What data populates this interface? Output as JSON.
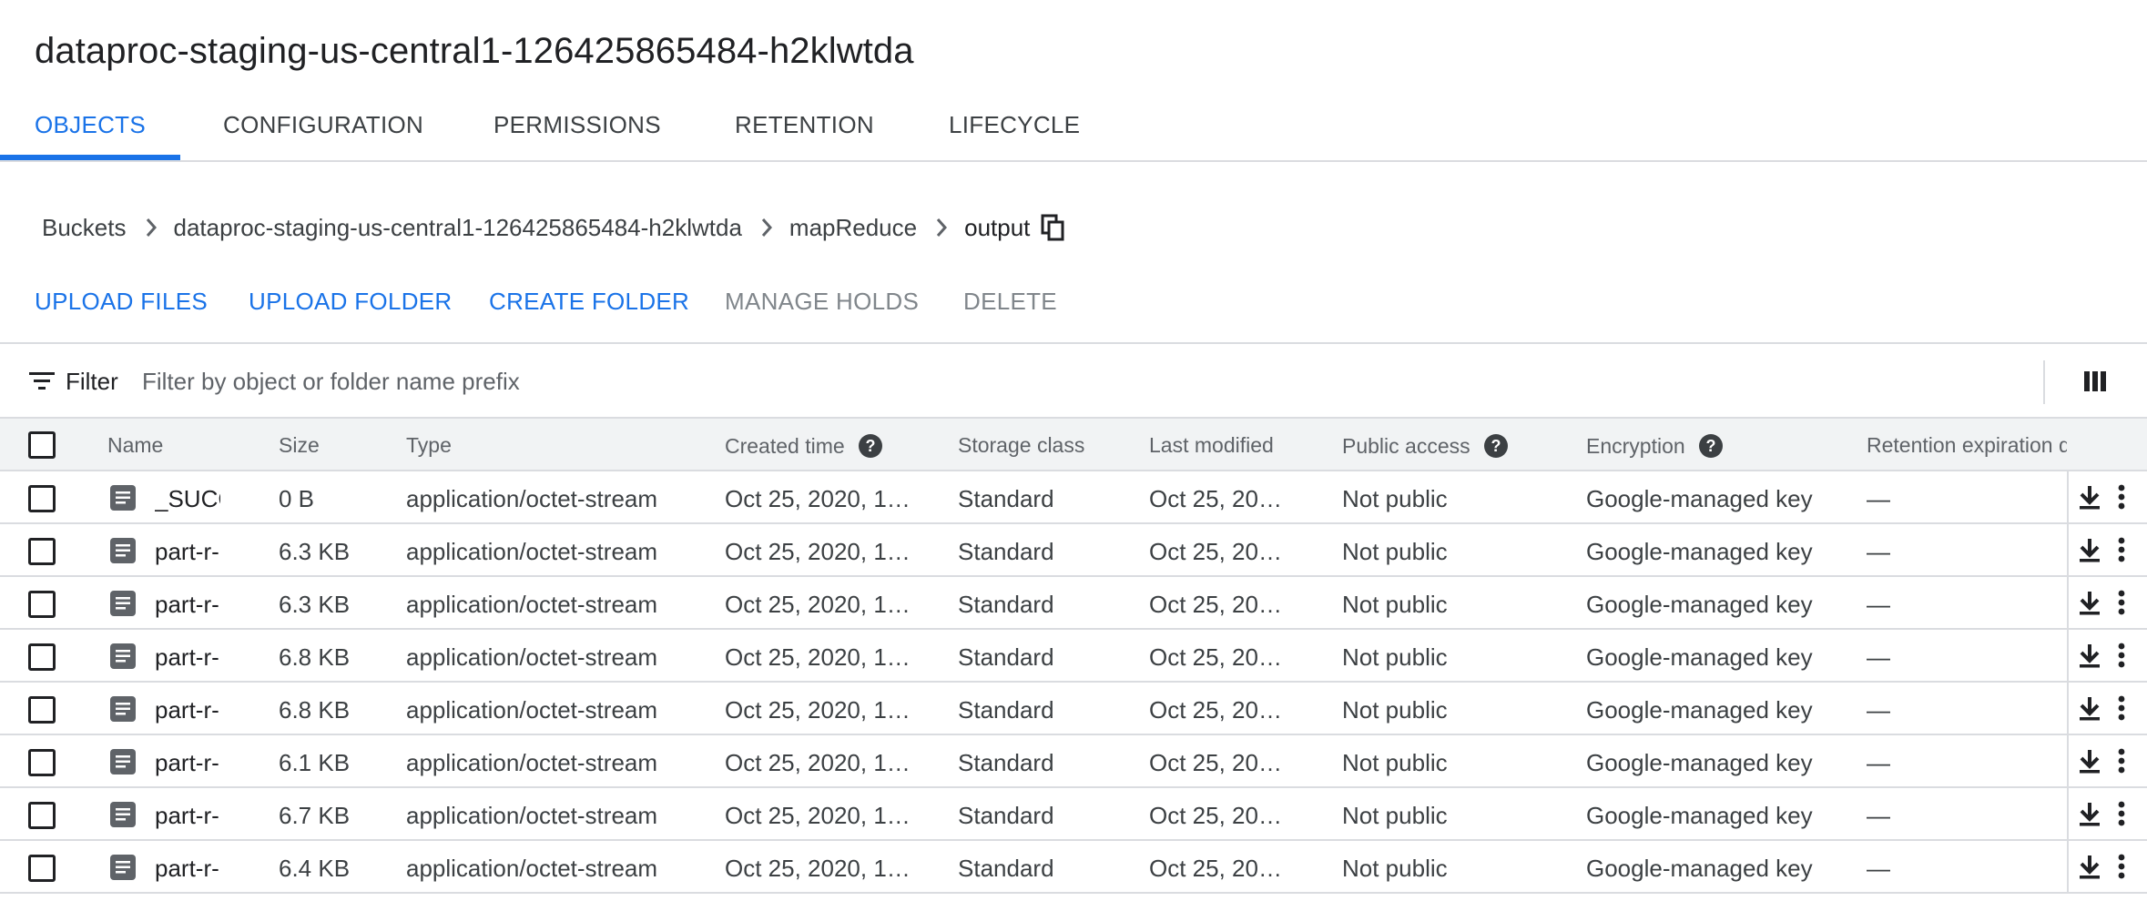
{
  "page_title": "dataproc-staging-us-central1-126425865484-h2klwtda",
  "tabs": [
    {
      "label": "OBJECTS",
      "active": true
    },
    {
      "label": "CONFIGURATION",
      "active": false
    },
    {
      "label": "PERMISSIONS",
      "active": false
    },
    {
      "label": "RETENTION",
      "active": false
    },
    {
      "label": "LIFECYCLE",
      "active": false
    }
  ],
  "breadcrumb": {
    "items": [
      "Buckets",
      "dataproc-staging-us-central1-126425865484-h2klwtda",
      "mapReduce",
      "output"
    ],
    "copy_icon": "copy-icon"
  },
  "actions": {
    "upload_files": "UPLOAD FILES",
    "upload_folder": "UPLOAD FOLDER",
    "create_folder": "CREATE FOLDER",
    "manage_holds": "MANAGE HOLDS",
    "delete": "DELETE"
  },
  "filter": {
    "label": "Filter",
    "placeholder": "Filter by object or folder name prefix",
    "value": ""
  },
  "table": {
    "columns": {
      "name": "Name",
      "size": "Size",
      "type": "Type",
      "created": "Created time",
      "storage": "Storage class",
      "modified": "Last modified",
      "public": "Public access",
      "encryption": "Encryption",
      "retention": "Retention expiration d"
    },
    "rows": [
      {
        "name": "_SUCC",
        "size": "0 B",
        "type": "application/octet-stream",
        "created": "Oct 25, 2020, 1…",
        "storage": "Standard",
        "modified": "Oct 25, 20…",
        "public": "Not public",
        "encryption": "Google-managed key",
        "retention": "—"
      },
      {
        "name": "part-r-",
        "size": "6.3 KB",
        "type": "application/octet-stream",
        "created": "Oct 25, 2020, 1…",
        "storage": "Standard",
        "modified": "Oct 25, 20…",
        "public": "Not public",
        "encryption": "Google-managed key",
        "retention": "—"
      },
      {
        "name": "part-r-",
        "size": "6.3 KB",
        "type": "application/octet-stream",
        "created": "Oct 25, 2020, 1…",
        "storage": "Standard",
        "modified": "Oct 25, 20…",
        "public": "Not public",
        "encryption": "Google-managed key",
        "retention": "—"
      },
      {
        "name": "part-r-",
        "size": "6.8 KB",
        "type": "application/octet-stream",
        "created": "Oct 25, 2020, 1…",
        "storage": "Standard",
        "modified": "Oct 25, 20…",
        "public": "Not public",
        "encryption": "Google-managed key",
        "retention": "—"
      },
      {
        "name": "part-r-",
        "size": "6.8 KB",
        "type": "application/octet-stream",
        "created": "Oct 25, 2020, 1…",
        "storage": "Standard",
        "modified": "Oct 25, 20…",
        "public": "Not public",
        "encryption": "Google-managed key",
        "retention": "—"
      },
      {
        "name": "part-r-",
        "size": "6.1 KB",
        "type": "application/octet-stream",
        "created": "Oct 25, 2020, 1…",
        "storage": "Standard",
        "modified": "Oct 25, 20…",
        "public": "Not public",
        "encryption": "Google-managed key",
        "retention": "—"
      },
      {
        "name": "part-r-",
        "size": "6.7 KB",
        "type": "application/octet-stream",
        "created": "Oct 25, 2020, 1…",
        "storage": "Standard",
        "modified": "Oct 25, 20…",
        "public": "Not public",
        "encryption": "Google-managed key",
        "retention": "—"
      },
      {
        "name": "part-r-",
        "size": "6.4 KB",
        "type": "application/octet-stream",
        "created": "Oct 25, 2020, 1…",
        "storage": "Standard",
        "modified": "Oct 25, 20…",
        "public": "Not public",
        "encryption": "Google-managed key",
        "retention": "—"
      }
    ]
  },
  "colors": {
    "accent": "#1a73e8",
    "text": "#202124",
    "muted": "#5f6368",
    "border": "#dadce0",
    "header_bg": "#f1f3f4"
  },
  "icons": [
    "chevron-right-icon",
    "copy-icon",
    "filter-icon",
    "columns-icon",
    "help-icon",
    "file-icon",
    "download-icon",
    "more-vert-icon"
  ]
}
